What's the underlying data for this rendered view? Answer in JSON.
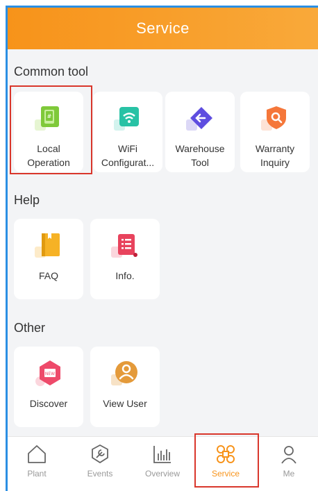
{
  "header": {
    "title": "Service"
  },
  "sections": {
    "common": {
      "title": "Common tool",
      "items": [
        {
          "line1": "Local",
          "line2": "Operation",
          "icon": "local-operation-icon"
        },
        {
          "line1": "WiFi",
          "line2": "Configurat...",
          "icon": "wifi-icon"
        },
        {
          "line1": "Warehouse",
          "line2": "Tool",
          "icon": "warehouse-icon"
        },
        {
          "line1": "Warranty",
          "line2": "Inquiry",
          "icon": "warranty-search-icon"
        }
      ]
    },
    "help": {
      "title": "Help",
      "items": [
        {
          "label": "FAQ",
          "icon": "faq-book-icon"
        },
        {
          "label": "Info.",
          "icon": "info-list-icon"
        }
      ]
    },
    "other": {
      "title": "Other",
      "items": [
        {
          "label": "Discover",
          "icon": "discover-new-icon"
        },
        {
          "label": "View User",
          "icon": "view-user-icon"
        }
      ]
    }
  },
  "tabbar": {
    "items": [
      {
        "label": "Plant",
        "icon": "house-icon",
        "active": false
      },
      {
        "label": "Events",
        "icon": "wrench-gear-icon",
        "active": false
      },
      {
        "label": "Overview",
        "icon": "bar-chart-icon",
        "active": false
      },
      {
        "label": "Service",
        "icon": "service-grid-icon",
        "active": true
      },
      {
        "label": "Me",
        "icon": "person-icon",
        "active": false
      }
    ]
  },
  "colors": {
    "accent": "#f7931a",
    "highlight": "#d9362b",
    "blue_border": "#2b8fe3"
  }
}
